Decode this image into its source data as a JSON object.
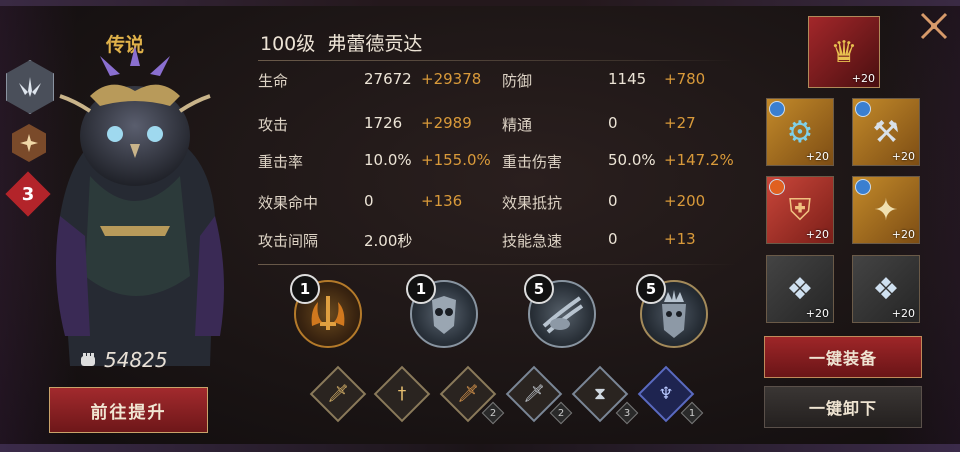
{
  "hero": {
    "rarity": "传说",
    "star_level": "3",
    "power": "54825",
    "upgrade_label": "前往提升"
  },
  "title": {
    "level": "100级",
    "name": "弗蕾德贡达"
  },
  "stats": [
    {
      "label": "生命",
      "value": "27672",
      "bonus": "+29378"
    },
    {
      "label": "防御",
      "value": "1145",
      "bonus": "+780"
    },
    {
      "label": "攻击",
      "value": "1726",
      "bonus": "+2989"
    },
    {
      "label": "精通",
      "value": "0",
      "bonus": "+27"
    },
    {
      "label": "重击率",
      "value": "10.0%",
      "bonus": "+155.0%"
    },
    {
      "label": "重击伤害",
      "value": "50.0%",
      "bonus": "+147.2%"
    },
    {
      "label": "效果命中",
      "value": "0",
      "bonus": "+136"
    },
    {
      "label": "效果抵抗",
      "value": "0",
      "bonus": "+200"
    },
    {
      "label": "攻击间隔",
      "value": "2.00秒",
      "bonus": ""
    },
    {
      "label": "技能急速",
      "value": "0",
      "bonus": "+13"
    }
  ],
  "skills": [
    {
      "level": "1",
      "icon": "flame-sword-icon"
    },
    {
      "level": "1",
      "icon": "owl-mask-icon"
    },
    {
      "level": "5",
      "icon": "claw-strike-icon"
    },
    {
      "level": "5",
      "icon": "owl-king-icon"
    }
  ],
  "runes": [
    {
      "icon": "sword-icon",
      "count": ""
    },
    {
      "icon": "sword-ground-icon",
      "count": ""
    },
    {
      "icon": "flame-sword-icon",
      "count": "2"
    },
    {
      "icon": "blade-icon",
      "count": "2"
    },
    {
      "icon": "hourglass-icon",
      "count": "3"
    },
    {
      "icon": "owl-emblem-icon",
      "count": "1"
    }
  ],
  "equipment": {
    "crown": {
      "plus": "+20"
    },
    "slots": [
      {
        "plus": "+20",
        "icon": "gauntlet-icon"
      },
      {
        "plus": "+20",
        "icon": "hammer-icon"
      },
      {
        "plus": "+20",
        "icon": "armor-icon"
      },
      {
        "plus": "+20",
        "icon": "bracer-icon"
      },
      {
        "plus": "+20",
        "icon": "crystal-icon"
      },
      {
        "plus": "+20",
        "icon": "crystal-icon"
      }
    ]
  },
  "buttons": {
    "equip_all": "一键装备",
    "unequip_all": "一键卸下"
  },
  "colors": {
    "bonus": "#d99a3a",
    "rarity": "#e0b24a",
    "button_red": "#9e2628"
  }
}
